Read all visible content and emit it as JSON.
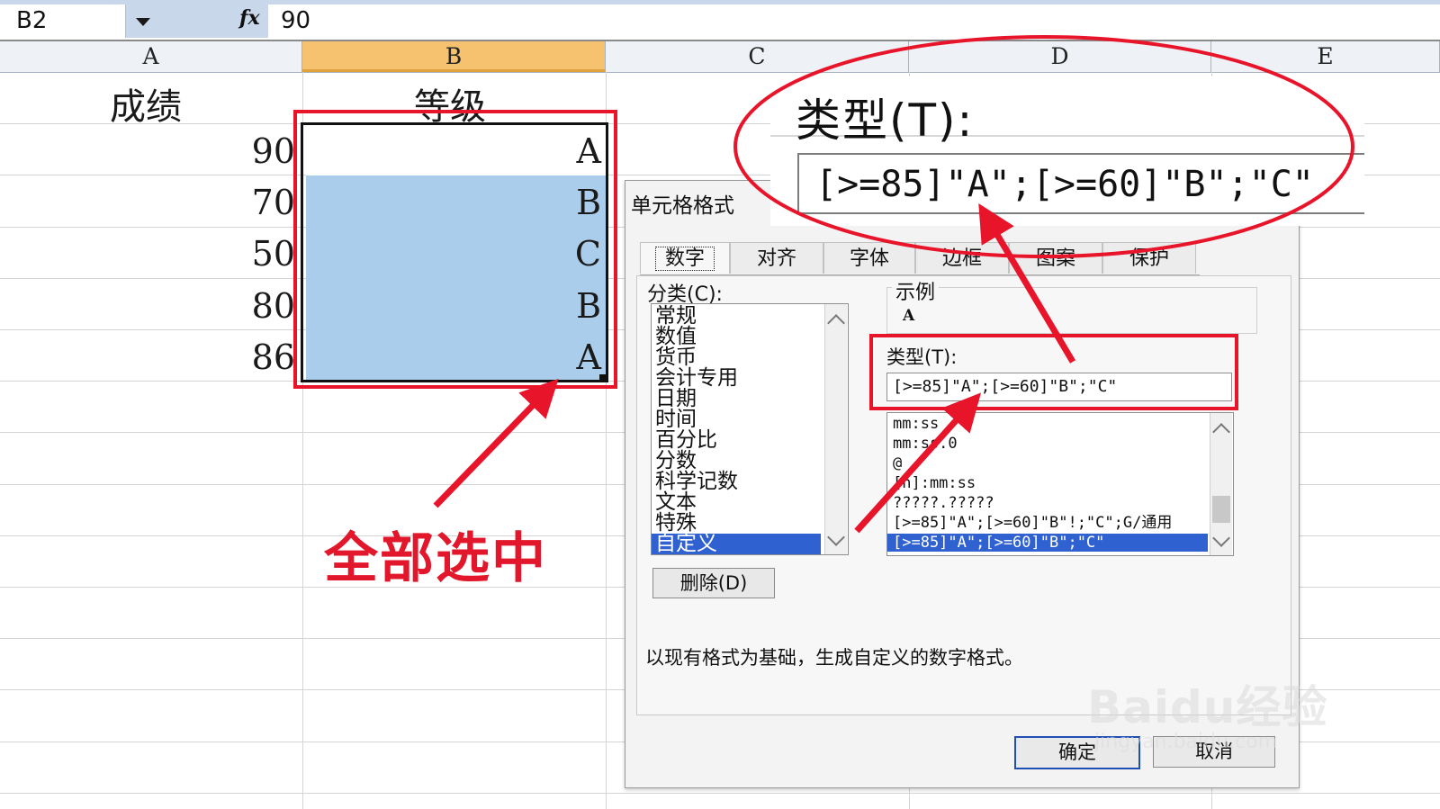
{
  "formula_bar": {
    "name_box": "B2",
    "fx_label": "fx",
    "value": "90"
  },
  "columns": [
    "A",
    "B",
    "C",
    "D",
    "E"
  ],
  "sheet": {
    "header_a": "成绩",
    "header_b": "等级",
    "rows": [
      {
        "score": "90",
        "grade": "A"
      },
      {
        "score": "70",
        "grade": "B"
      },
      {
        "score": "50",
        "grade": "C"
      },
      {
        "score": "80",
        "grade": "B"
      },
      {
        "score": "86",
        "grade": "A"
      }
    ]
  },
  "dialog": {
    "title": "单元格格式",
    "tabs": [
      "数字",
      "对齐",
      "字体",
      "边框",
      "图案",
      "保护"
    ],
    "category_label": "分类(C):",
    "categories": [
      "常规",
      "数值",
      "货币",
      "会计专用",
      "日期",
      "时间",
      "百分比",
      "分数",
      "科学记数",
      "文本",
      "特殊",
      "自定义"
    ],
    "selected_category": "自定义",
    "delete_button": "删除(D)",
    "sample_label": "示例",
    "sample_value": "A",
    "type_label": "类型(T):",
    "type_value": "[>=85]\"A\";[>=60]\"B\";\"C\"",
    "format_list": [
      "mm:ss",
      "mm:ss.0",
      "@",
      "[h]:mm:ss",
      "?????.?????",
      "[>=85]\"A\";[>=60]\"B\"!;\"C\";G/通用",
      "[>=85]\"A\";[>=60]\"B\";\"C\""
    ],
    "description": "以现有格式为基础，生成自定义的数字格式。",
    "ok_button": "确定",
    "cancel_button": "取消"
  },
  "zoom": {
    "type_label": "类型(T):",
    "type_value": "[>=85]\"A\";[>=60]\"B\";\"C\""
  },
  "annotation": {
    "text": "全部选中",
    "color": "#e2172b"
  },
  "watermark": {
    "text": "Baidu经验",
    "sub": "jingyan.baidu.com"
  },
  "colors": {
    "selection_fill": "#a9cdeb",
    "selected_header": "#f7c26f",
    "list_highlight": "#2f62d0",
    "callout_red": "#e2172b"
  }
}
